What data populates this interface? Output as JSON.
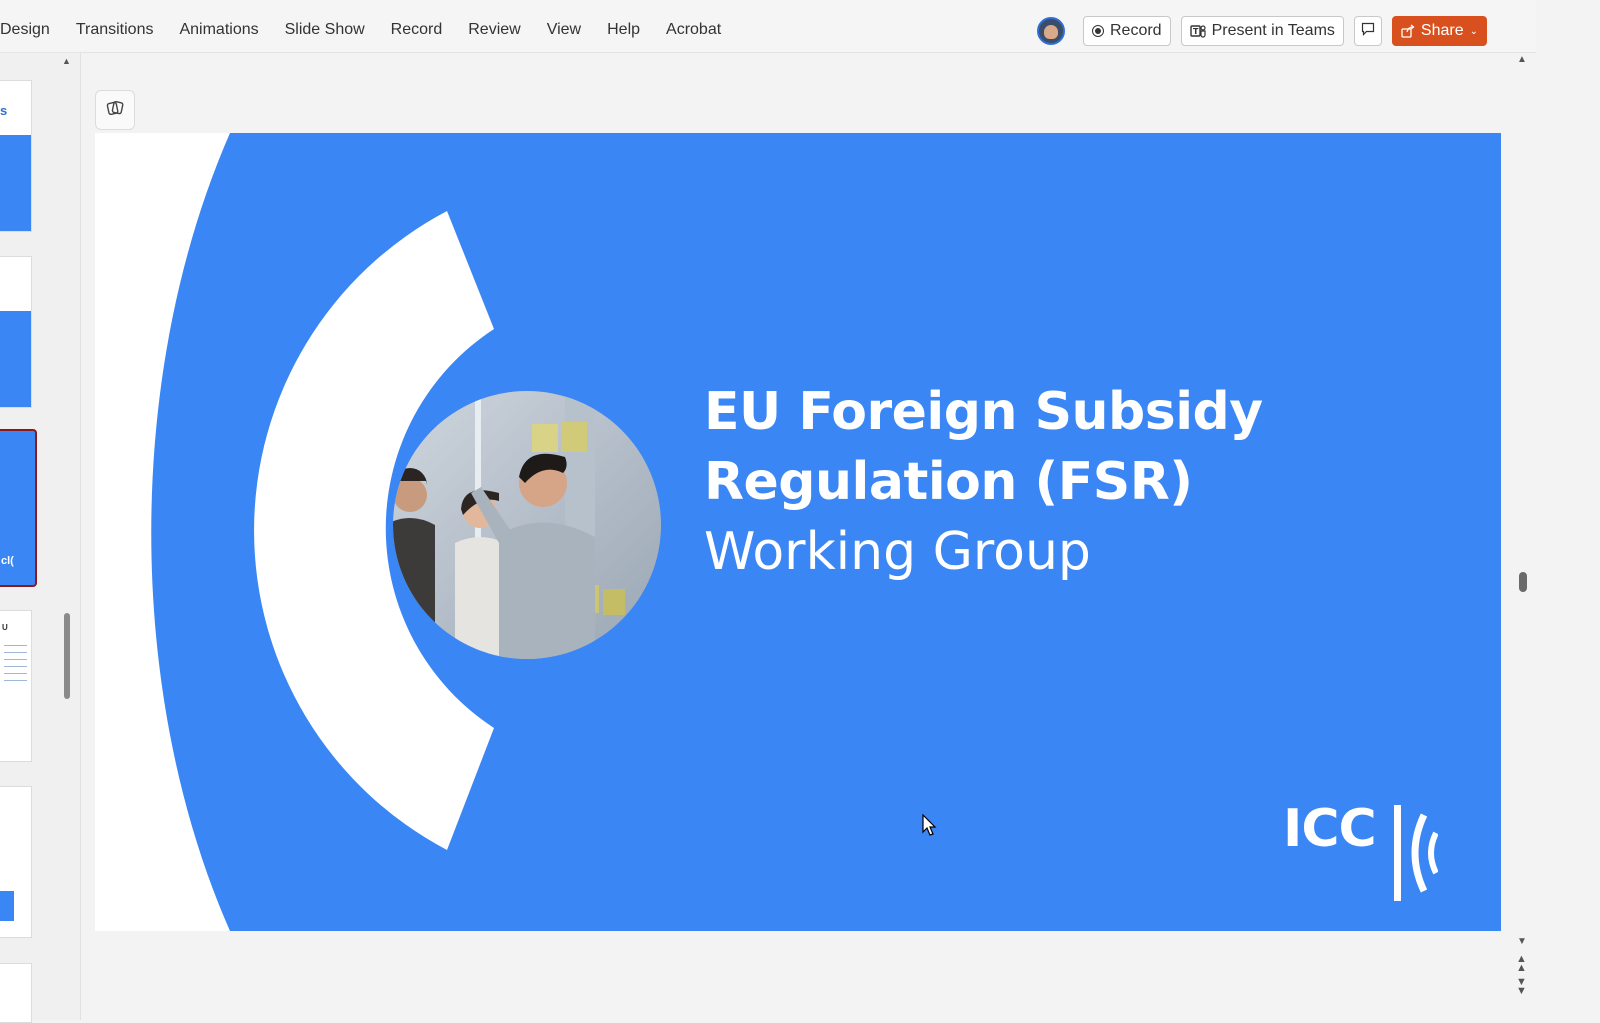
{
  "ribbon": {
    "tabs": [
      "Design",
      "Transitions",
      "Animations",
      "Slide Show",
      "Record",
      "Review",
      "View",
      "Help",
      "Acrobat"
    ],
    "record_button": "Record",
    "present_teams_button": "Present in Teams",
    "share_button": "Share"
  },
  "slide": {
    "title_line1": "EU Foreign Subsidy",
    "title_line2": "Regulation (FSR)",
    "subtitle": "Working Group",
    "logo_text": "ICC"
  },
  "colors": {
    "slide_blue": "#3a86f4",
    "share_orange": "#d9501f",
    "selected_thumb_border": "#8b1a1a"
  },
  "icons": [
    "avatar",
    "record-icon",
    "teams-icon",
    "comment-icon",
    "share-icon",
    "designer-icon",
    "cursor-icon"
  ]
}
